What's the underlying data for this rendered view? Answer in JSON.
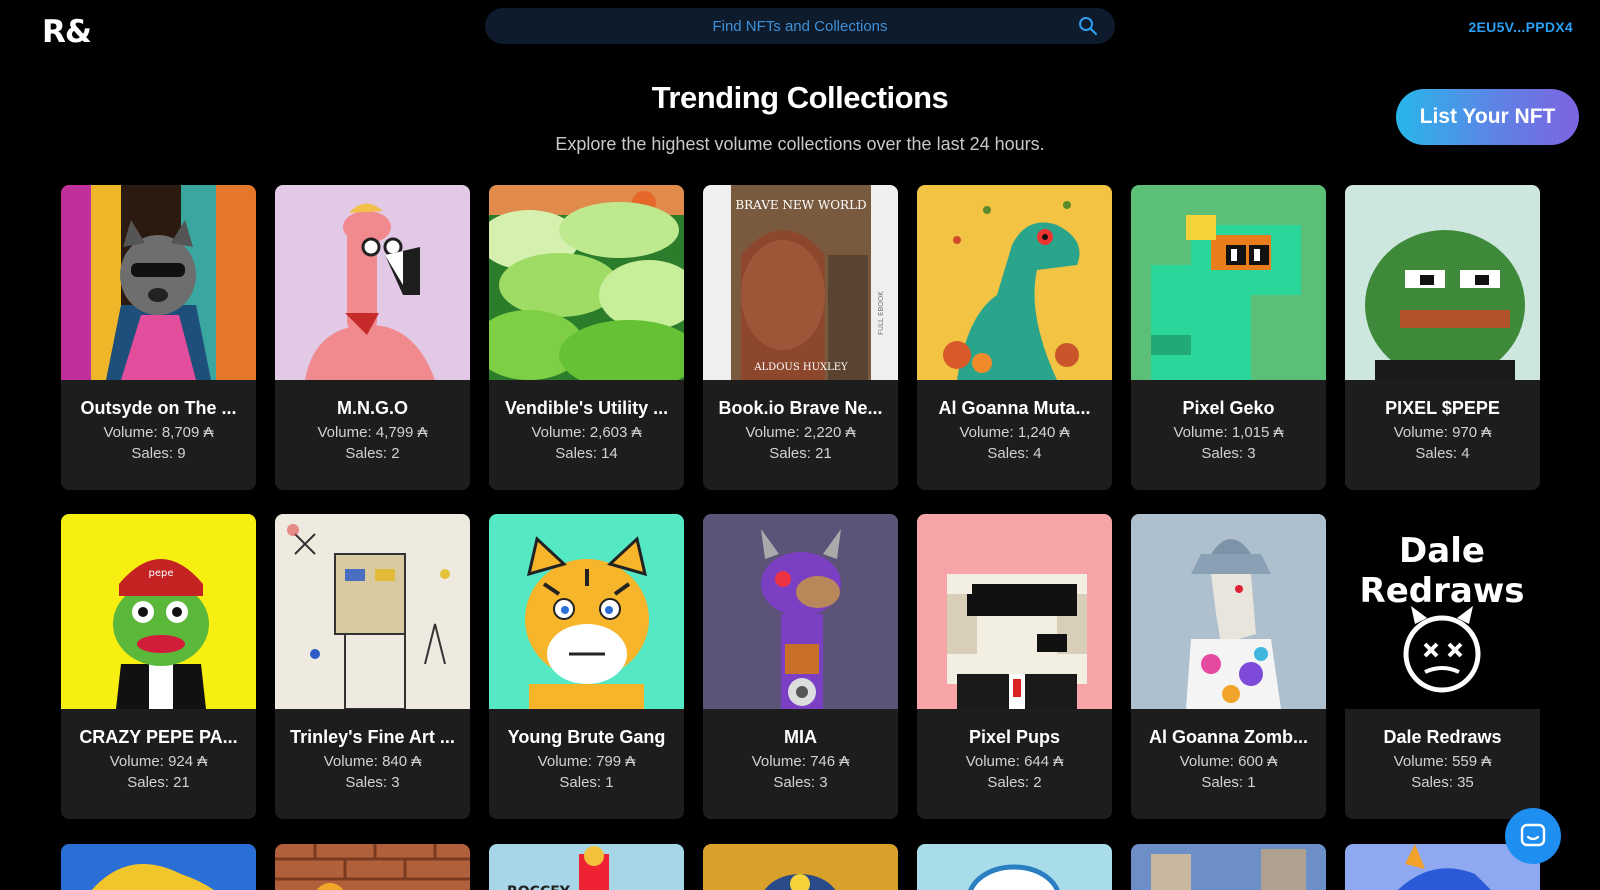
{
  "header": {
    "logo": "R&",
    "search_placeholder": "Find NFTs and Collections",
    "wallet": "2EU5V...PPDX4"
  },
  "main": {
    "title": "Trending Collections",
    "subtitle": "Explore the highest volume collections over the last 24 hours.",
    "list_button": "List Your NFT"
  },
  "currency_symbol": "₳",
  "collections": [
    {
      "name": "Outsyde on The ...",
      "volume": "Volume: 8,709 ₳",
      "sales": "Sales: 9",
      "art": "raccoon",
      "bg": "#2b1a0f"
    },
    {
      "name": "M.N.G.O",
      "volume": "Volume: 4,799 ₳",
      "sales": "Sales: 2",
      "art": "flamingo",
      "bg": "#e2c9e6"
    },
    {
      "name": "Vendible's Utility ...",
      "volume": "Volume: 2,603 ₳",
      "sales": "Sales: 14",
      "art": "clouds",
      "bg": "#6fc83f"
    },
    {
      "name": "Book.io Brave Ne...",
      "volume": "Volume: 2,220 ₳",
      "sales": "Sales: 21",
      "art": "book",
      "bg": "#f2f2f2"
    },
    {
      "name": "Al Goanna Muta...",
      "volume": "Volume: 1,240 ₳",
      "sales": "Sales: 4",
      "art": "lizard",
      "bg": "#f3c343"
    },
    {
      "name": "Pixel Geko",
      "volume": "Volume: 1,015 ₳",
      "sales": "Sales: 3",
      "art": "geko",
      "bg": "#5cbf78"
    },
    {
      "name": "PIXEL $PEPE",
      "volume": "Volume: 970 ₳",
      "sales": "Sales: 4",
      "art": "pepe",
      "bg": "#cde7df"
    },
    {
      "name": "CRAZY PEPE PA...",
      "volume": "Volume: 924 ₳",
      "sales": "Sales: 21",
      "art": "crazypepe",
      "bg": "#f7ee12"
    },
    {
      "name": "Trinley's Fine Art ...",
      "volume": "Volume: 840 ₳",
      "sales": "Sales: 3",
      "art": "sketch",
      "bg": "#eeeae0"
    },
    {
      "name": "Young Brute Gang",
      "volume": "Volume: 799 ₳",
      "sales": "Sales: 1",
      "art": "tiger",
      "bg": "#55e8c5"
    },
    {
      "name": "MIA",
      "volume": "Volume: 746 ₳",
      "sales": "Sales: 3",
      "art": "mia",
      "bg": "#5c5378"
    },
    {
      "name": "Pixel Pups",
      "volume": "Volume: 644 ₳",
      "sales": "Sales: 2",
      "art": "pup",
      "bg": "#f6a4a8"
    },
    {
      "name": "Al Goanna Zomb...",
      "volume": "Volume: 600 ₳",
      "sales": "Sales: 1",
      "art": "zombie",
      "bg": "#aebfcd"
    },
    {
      "name": "Dale Redraws",
      "volume": "Volume: 559 ₳",
      "sales": "Sales: 35",
      "art": "dale",
      "bg": "#000000"
    }
  ],
  "peek_row": [
    {
      "art": "peek1",
      "bg": "#2a6fd6"
    },
    {
      "art": "peek2",
      "bg": "#b0603a"
    },
    {
      "art": "peek3",
      "bg": "#a6d6e8"
    },
    {
      "art": "peek4",
      "bg": "#d9a12a"
    },
    {
      "art": "peek5",
      "bg": "#a8dce8"
    },
    {
      "art": "peek6",
      "bg": "#6c8fc8"
    },
    {
      "art": "peek7",
      "bg": "#8ea8f2"
    }
  ],
  "book_text": {
    "top": "BRAVE NEW WORLD",
    "bottom": "ALDOUS HUXLEY",
    "side": "FULL EBOOK"
  },
  "dale_text": {
    "line1": "Dale",
    "line2": "Redraws"
  },
  "pepe_hat": "pepe",
  "peek3_text": "ROCCEY"
}
